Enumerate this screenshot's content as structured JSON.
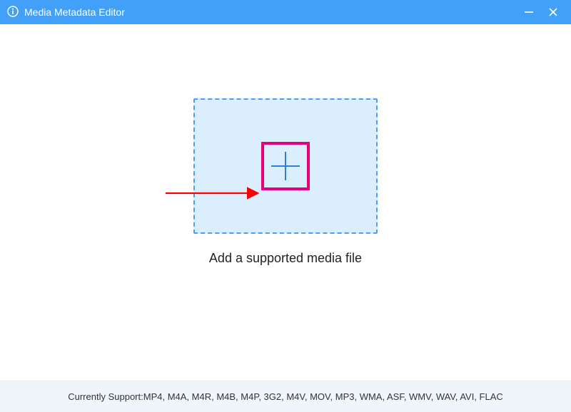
{
  "titlebar": {
    "title": "Media Metadata Editor"
  },
  "main": {
    "caption": "Add a supported media file"
  },
  "footer": {
    "label": "Currently Support: ",
    "formats": "MP4, M4A, M4R, M4B, M4P, 3G2, M4V, MOV, MP3, WMA, ASF, WMV, WAV, AVI, FLAC"
  }
}
